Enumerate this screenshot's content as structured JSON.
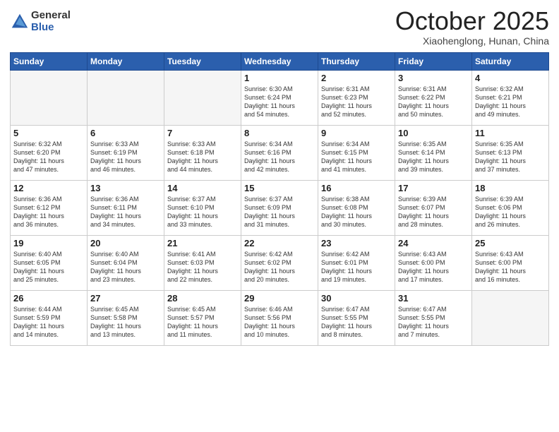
{
  "header": {
    "logo_general": "General",
    "logo_blue": "Blue",
    "month_title": "October 2025",
    "location": "Xiaohenglong, Hunan, China"
  },
  "days_of_week": [
    "Sunday",
    "Monday",
    "Tuesday",
    "Wednesday",
    "Thursday",
    "Friday",
    "Saturday"
  ],
  "weeks": [
    [
      {
        "day": "",
        "info": ""
      },
      {
        "day": "",
        "info": ""
      },
      {
        "day": "",
        "info": ""
      },
      {
        "day": "1",
        "info": "Sunrise: 6:30 AM\nSunset: 6:24 PM\nDaylight: 11 hours\nand 54 minutes."
      },
      {
        "day": "2",
        "info": "Sunrise: 6:31 AM\nSunset: 6:23 PM\nDaylight: 11 hours\nand 52 minutes."
      },
      {
        "day": "3",
        "info": "Sunrise: 6:31 AM\nSunset: 6:22 PM\nDaylight: 11 hours\nand 50 minutes."
      },
      {
        "day": "4",
        "info": "Sunrise: 6:32 AM\nSunset: 6:21 PM\nDaylight: 11 hours\nand 49 minutes."
      }
    ],
    [
      {
        "day": "5",
        "info": "Sunrise: 6:32 AM\nSunset: 6:20 PM\nDaylight: 11 hours\nand 47 minutes."
      },
      {
        "day": "6",
        "info": "Sunrise: 6:33 AM\nSunset: 6:19 PM\nDaylight: 11 hours\nand 46 minutes."
      },
      {
        "day": "7",
        "info": "Sunrise: 6:33 AM\nSunset: 6:18 PM\nDaylight: 11 hours\nand 44 minutes."
      },
      {
        "day": "8",
        "info": "Sunrise: 6:34 AM\nSunset: 6:16 PM\nDaylight: 11 hours\nand 42 minutes."
      },
      {
        "day": "9",
        "info": "Sunrise: 6:34 AM\nSunset: 6:15 PM\nDaylight: 11 hours\nand 41 minutes."
      },
      {
        "day": "10",
        "info": "Sunrise: 6:35 AM\nSunset: 6:14 PM\nDaylight: 11 hours\nand 39 minutes."
      },
      {
        "day": "11",
        "info": "Sunrise: 6:35 AM\nSunset: 6:13 PM\nDaylight: 11 hours\nand 37 minutes."
      }
    ],
    [
      {
        "day": "12",
        "info": "Sunrise: 6:36 AM\nSunset: 6:12 PM\nDaylight: 11 hours\nand 36 minutes."
      },
      {
        "day": "13",
        "info": "Sunrise: 6:36 AM\nSunset: 6:11 PM\nDaylight: 11 hours\nand 34 minutes."
      },
      {
        "day": "14",
        "info": "Sunrise: 6:37 AM\nSunset: 6:10 PM\nDaylight: 11 hours\nand 33 minutes."
      },
      {
        "day": "15",
        "info": "Sunrise: 6:37 AM\nSunset: 6:09 PM\nDaylight: 11 hours\nand 31 minutes."
      },
      {
        "day": "16",
        "info": "Sunrise: 6:38 AM\nSunset: 6:08 PM\nDaylight: 11 hours\nand 30 minutes."
      },
      {
        "day": "17",
        "info": "Sunrise: 6:39 AM\nSunset: 6:07 PM\nDaylight: 11 hours\nand 28 minutes."
      },
      {
        "day": "18",
        "info": "Sunrise: 6:39 AM\nSunset: 6:06 PM\nDaylight: 11 hours\nand 26 minutes."
      }
    ],
    [
      {
        "day": "19",
        "info": "Sunrise: 6:40 AM\nSunset: 6:05 PM\nDaylight: 11 hours\nand 25 minutes."
      },
      {
        "day": "20",
        "info": "Sunrise: 6:40 AM\nSunset: 6:04 PM\nDaylight: 11 hours\nand 23 minutes."
      },
      {
        "day": "21",
        "info": "Sunrise: 6:41 AM\nSunset: 6:03 PM\nDaylight: 11 hours\nand 22 minutes."
      },
      {
        "day": "22",
        "info": "Sunrise: 6:42 AM\nSunset: 6:02 PM\nDaylight: 11 hours\nand 20 minutes."
      },
      {
        "day": "23",
        "info": "Sunrise: 6:42 AM\nSunset: 6:01 PM\nDaylight: 11 hours\nand 19 minutes."
      },
      {
        "day": "24",
        "info": "Sunrise: 6:43 AM\nSunset: 6:00 PM\nDaylight: 11 hours\nand 17 minutes."
      },
      {
        "day": "25",
        "info": "Sunrise: 6:43 AM\nSunset: 6:00 PM\nDaylight: 11 hours\nand 16 minutes."
      }
    ],
    [
      {
        "day": "26",
        "info": "Sunrise: 6:44 AM\nSunset: 5:59 PM\nDaylight: 11 hours\nand 14 minutes."
      },
      {
        "day": "27",
        "info": "Sunrise: 6:45 AM\nSunset: 5:58 PM\nDaylight: 11 hours\nand 13 minutes."
      },
      {
        "day": "28",
        "info": "Sunrise: 6:45 AM\nSunset: 5:57 PM\nDaylight: 11 hours\nand 11 minutes."
      },
      {
        "day": "29",
        "info": "Sunrise: 6:46 AM\nSunset: 5:56 PM\nDaylight: 11 hours\nand 10 minutes."
      },
      {
        "day": "30",
        "info": "Sunrise: 6:47 AM\nSunset: 5:55 PM\nDaylight: 11 hours\nand 8 minutes."
      },
      {
        "day": "31",
        "info": "Sunrise: 6:47 AM\nSunset: 5:55 PM\nDaylight: 11 hours\nand 7 minutes."
      },
      {
        "day": "",
        "info": ""
      }
    ]
  ]
}
